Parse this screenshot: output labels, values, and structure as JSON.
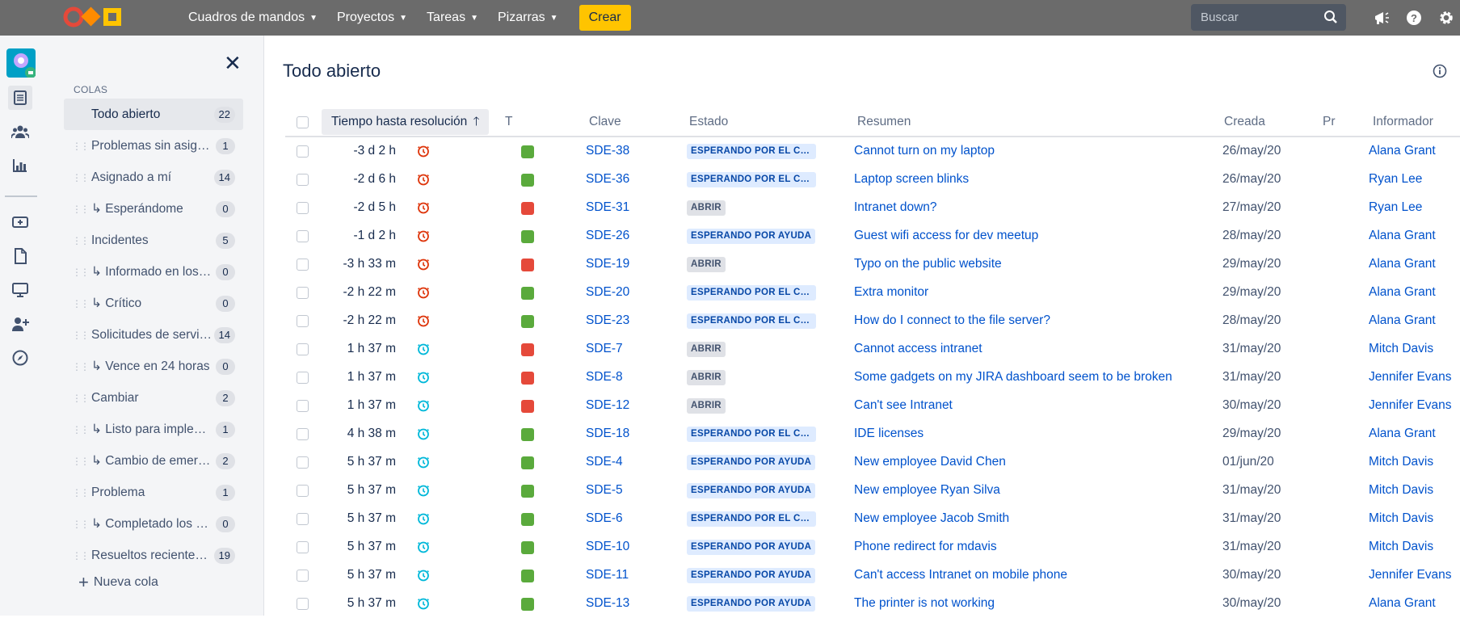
{
  "topbar": {
    "nav": [
      {
        "label": "Cuadros de mandos",
        "icon": "chevron-down-icon"
      },
      {
        "label": "Proyectos",
        "icon": "chevron-down-icon"
      },
      {
        "label": "Tareas",
        "icon": "chevron-down-icon"
      },
      {
        "label": "Pizarras",
        "icon": "chevron-down-icon"
      }
    ],
    "create_label": "Crear",
    "search_placeholder": "Buscar",
    "colors": {
      "bar": "#6b6b6b",
      "create": "#ffc400"
    }
  },
  "queues": {
    "heading": "COLAS",
    "items": [
      {
        "label": "Todo abierto",
        "count": "22",
        "active": true
      },
      {
        "label": "Problemas sin asignar",
        "count": "1"
      },
      {
        "label": "Asignado a mí",
        "count": "14"
      },
      {
        "label": "↳ Esperándome",
        "count": "0"
      },
      {
        "label": "Incidentes",
        "count": "5"
      },
      {
        "label": "↳ Informado en los últimos",
        "count": "0"
      },
      {
        "label": "↳ Crítico",
        "count": "0"
      },
      {
        "label": "Solicitudes de servicio",
        "count": "14"
      },
      {
        "label": "↳ Vence en 24 horas",
        "count": "0"
      },
      {
        "label": "Cambiar",
        "count": "2"
      },
      {
        "label": "↳ Listo para implementar",
        "count": "1"
      },
      {
        "label": "↳ Cambio de emergencia",
        "count": "2"
      },
      {
        "label": "Problema",
        "count": "1"
      },
      {
        "label": "↳ Completado los últimos",
        "count": "0"
      },
      {
        "label": "Resueltos recientemente",
        "count": "19"
      }
    ],
    "new_queue": "Nueva cola"
  },
  "main": {
    "title": "Todo abierto",
    "columns": {
      "time": "Tiempo hasta resolución",
      "type": "T",
      "key": "Clave",
      "status": "Estado",
      "summary": "Resumen",
      "created": "Creada",
      "priority": "Pr",
      "reporter": "Informador"
    },
    "rows": [
      {
        "time": "-3 d 2 h",
        "clock": "overdue",
        "type": "green",
        "key": "SDE-38",
        "status": "ESPERANDO POR EL CLIENTE",
        "status_kind": "wait",
        "summary": "Cannot turn on my laptop",
        "created": "26/may/20",
        "reporter": "Alana Grant"
      },
      {
        "time": "-2 d 6 h",
        "clock": "overdue",
        "type": "green",
        "key": "SDE-36",
        "status": "ESPERANDO POR EL CLIENTE",
        "status_kind": "wait",
        "summary": "Laptop screen blinks",
        "created": "26/may/20",
        "reporter": "Ryan Lee"
      },
      {
        "time": "-2 d 5 h",
        "clock": "overdue",
        "type": "red",
        "key": "SDE-31",
        "status": "ABRIR",
        "status_kind": "open",
        "summary": "Intranet down?",
        "created": "27/may/20",
        "reporter": "Ryan Lee"
      },
      {
        "time": "-1 d 2 h",
        "clock": "overdue",
        "type": "green",
        "key": "SDE-26",
        "status": "ESPERANDO POR AYUDA",
        "status_kind": "wait",
        "summary": "Guest wifi access for dev meetup",
        "created": "28/may/20",
        "reporter": "Alana Grant"
      },
      {
        "time": "-3 h 33 m",
        "clock": "overdue",
        "type": "red",
        "key": "SDE-19",
        "status": "ABRIR",
        "status_kind": "open",
        "summary": "Typo on the public website",
        "created": "29/may/20",
        "reporter": "Alana Grant"
      },
      {
        "time": "-2 h 22 m",
        "clock": "overdue",
        "type": "green",
        "key": "SDE-20",
        "status": "ESPERANDO POR EL CLIENTE",
        "status_kind": "wait",
        "summary": "Extra monitor",
        "created": "29/may/20",
        "reporter": "Alana Grant"
      },
      {
        "time": "-2 h 22 m",
        "clock": "overdue",
        "type": "green",
        "key": "SDE-23",
        "status": "ESPERANDO POR EL CLIENTE",
        "status_kind": "wait",
        "summary": "How do I connect to the file server?",
        "created": "28/may/20",
        "reporter": "Alana Grant"
      },
      {
        "time": "1 h 37 m",
        "clock": "ok",
        "type": "red",
        "key": "SDE-7",
        "status": "ABRIR",
        "status_kind": "open",
        "summary": "Cannot access intranet",
        "created": "31/may/20",
        "reporter": "Mitch Davis"
      },
      {
        "time": "1 h 37 m",
        "clock": "ok",
        "type": "red",
        "key": "SDE-8",
        "status": "ABRIR",
        "status_kind": "open",
        "summary": "Some gadgets on my JIRA dashboard seem to be broken",
        "created": "31/may/20",
        "reporter": "Jennifer Evans"
      },
      {
        "time": "1 h 37 m",
        "clock": "ok",
        "type": "red",
        "key": "SDE-12",
        "status": "ABRIR",
        "status_kind": "open",
        "summary": "Can't see Intranet",
        "created": "30/may/20",
        "reporter": "Jennifer Evans"
      },
      {
        "time": "4 h 38 m",
        "clock": "ok",
        "type": "green",
        "key": "SDE-18",
        "status": "ESPERANDO POR EL CLIENTE",
        "status_kind": "wait",
        "summary": "IDE licenses",
        "created": "29/may/20",
        "reporter": "Alana Grant"
      },
      {
        "time": "5 h 37 m",
        "clock": "ok",
        "type": "green",
        "key": "SDE-4",
        "status": "ESPERANDO POR AYUDA",
        "status_kind": "wait",
        "summary": "New employee David Chen",
        "created": "01/jun/20",
        "reporter": "Mitch Davis"
      },
      {
        "time": "5 h 37 m",
        "clock": "ok",
        "type": "green",
        "key": "SDE-5",
        "status": "ESPERANDO POR AYUDA",
        "status_kind": "wait",
        "summary": "New employee Ryan Silva",
        "created": "31/may/20",
        "reporter": "Mitch Davis"
      },
      {
        "time": "5 h 37 m",
        "clock": "ok",
        "type": "green",
        "key": "SDE-6",
        "status": "ESPERANDO POR EL CLIENTE",
        "status_kind": "wait",
        "summary": "New employee Jacob Smith",
        "created": "31/may/20",
        "reporter": "Mitch Davis"
      },
      {
        "time": "5 h 37 m",
        "clock": "ok",
        "type": "green",
        "key": "SDE-10",
        "status": "ESPERANDO POR AYUDA",
        "status_kind": "wait",
        "summary": "Phone redirect for mdavis",
        "created": "31/may/20",
        "reporter": "Mitch Davis"
      },
      {
        "time": "5 h 37 m",
        "clock": "ok",
        "type": "green",
        "key": "SDE-11",
        "status": "ESPERANDO POR AYUDA",
        "status_kind": "wait",
        "summary": "Can't access Intranet on mobile phone",
        "created": "30/may/20",
        "reporter": "Jennifer Evans"
      },
      {
        "time": "5 h 37 m",
        "clock": "ok",
        "type": "green",
        "key": "SDE-13",
        "status": "ESPERANDO POR AYUDA",
        "status_kind": "wait",
        "summary": "The printer is not working",
        "created": "30/may/20",
        "reporter": "Alana Grant"
      }
    ],
    "colors": {
      "overdue": "#de350b",
      "ok": "#00b8d9",
      "link": "#0052cc"
    }
  }
}
